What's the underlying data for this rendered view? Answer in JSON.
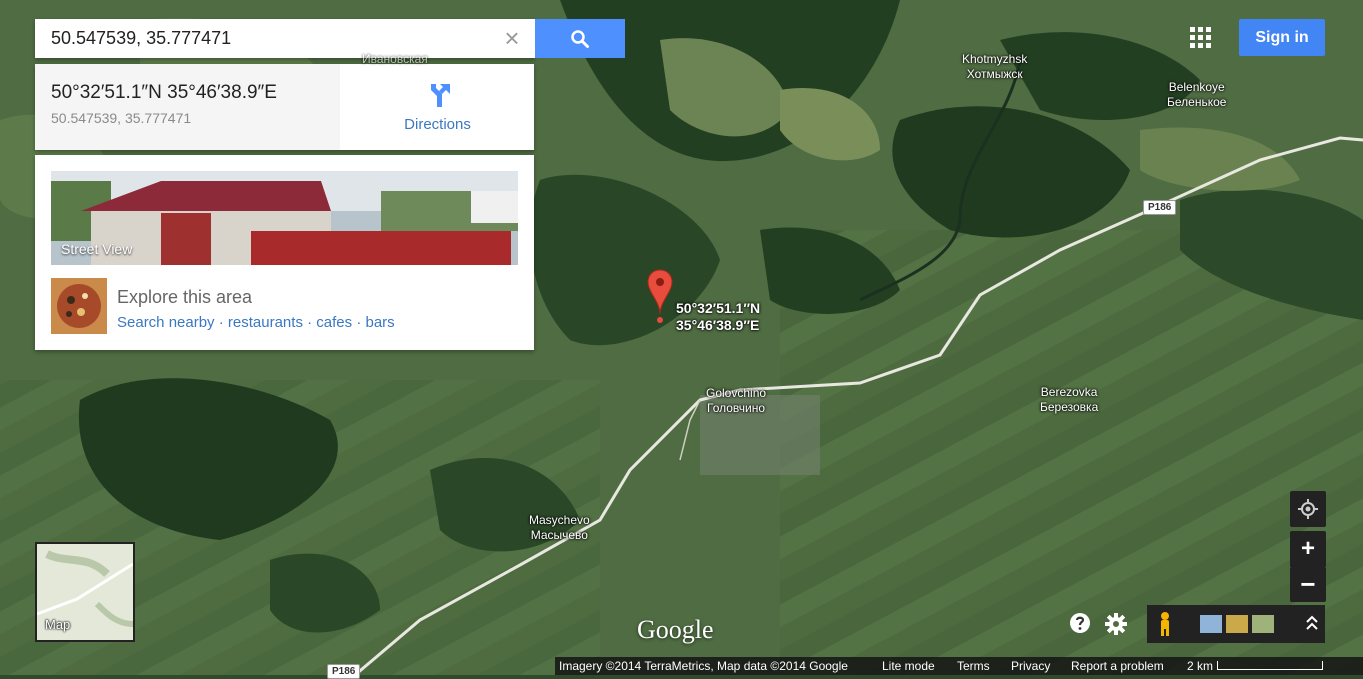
{
  "search": {
    "value": "50.547539, 35.777471",
    "clear_label": "×"
  },
  "coords_card": {
    "dms": "50°32′51.1″N 35°46′38.9″E",
    "decimal": "50.547539, 35.777471",
    "directions_label": "Directions"
  },
  "explore_card": {
    "streetview_label": "Street View",
    "title": "Explore this area",
    "links": [
      "Search nearby",
      "restaurants",
      "cafes",
      "bars"
    ],
    "separator": " · "
  },
  "header": {
    "signin_label": "Sign in"
  },
  "marker": {
    "line1": "50°32′51.1″N",
    "line2": "35°46′38.9″E"
  },
  "places": [
    {
      "latin": "Khotmyzhsk",
      "cyrillic": "Хотмыжск"
    },
    {
      "latin": "Belenkoye",
      "cyrillic": "Беленькое"
    },
    {
      "latin": "Golovchino",
      "cyrillic": "Головчино"
    },
    {
      "latin": "Berezovka",
      "cyrillic": "Березовка"
    },
    {
      "latin": "Masychevo",
      "cyrillic": "Масычево"
    },
    {
      "latin": "",
      "cyrillic": "Ивановская"
    }
  ],
  "roads": [
    "P186",
    "P186"
  ],
  "map_switch": {
    "label": "Map"
  },
  "controls": {
    "zoom_in": "+",
    "zoom_out": "−"
  },
  "branding": {
    "logo": "Google"
  },
  "footer": {
    "attribution": "Imagery ©2014 TerraMetrics, Map data ©2014 Google",
    "lite_mode": "Lite mode",
    "terms": "Terms",
    "privacy": "Privacy",
    "report": "Report a problem",
    "scale": "2 km"
  },
  "colors": {
    "accent_blue": "#4d90fe",
    "link_blue": "#3a78c3",
    "signin_blue": "#4285f4",
    "marker_red": "#e74c3c"
  }
}
